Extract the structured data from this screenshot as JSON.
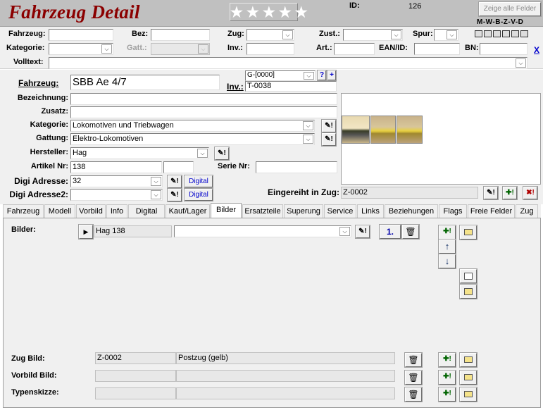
{
  "header": {
    "title": "Fahrzeug Detail",
    "stars": "★★★★★",
    "id_label": "ID:",
    "id_value": "126",
    "show_fields_button": "Zeige alle Felder",
    "mode_flags": "M-W-B-Z-V-D"
  },
  "filter": {
    "fahrzeug_label": "Fahrzeug:",
    "bez_label": "Bez:",
    "zug_label": "Zug:",
    "zust_label": "Zust.:",
    "spur_label": "Spur:",
    "kategorie_label": "Kategorie:",
    "gatt_label": "Gatt.:",
    "inv_label": "Inv.:",
    "art_label": "Art.:",
    "ean_label": "EAN/ID:",
    "bn_label": "BN:",
    "volltext_label": "Volltext:",
    "close_link": "X"
  },
  "detail": {
    "fahrzeug_label": "Fahrzeug:",
    "fahrzeug_value": "SBB Ae 4/7",
    "group_value": "G-[0000]",
    "question_button": "?",
    "plus_button": "+",
    "inv_label": "Inv.:",
    "inv_value": "T-0038",
    "bezeichnung_label": "Bezeichnung:",
    "bezeichnung_value": "",
    "zusatz_label": "Zusatz:",
    "zusatz_value": "",
    "kategorie_label": "Kategorie:",
    "kategorie_value": "Lokomotiven und Triebwagen",
    "gattung_label": "Gattung:",
    "gattung_value": "Elektro-Lokomotiven",
    "hersteller_label": "Hersteller:",
    "hersteller_value": "Hag",
    "artikel_label": "Artikel Nr:",
    "artikel_value": "138",
    "serie_label": "Serie Nr:",
    "serie_value": "",
    "digi1_label": "Digi Adresse:",
    "digi1_value": "32",
    "digi2_label": "Digi Adresse2:",
    "digi2_value": "",
    "digital_button": "Digital",
    "eingereiht_label": "Eingereiht in Zug:",
    "eingereiht_value": "Z-0002",
    "edit_icon": "✎!",
    "add_icon": "✚!",
    "delete_icon": "✖!"
  },
  "tabs": [
    "Fahrzeug",
    "Modell",
    "Vorbild",
    "Info",
    "Digital",
    "Kauf/Lager",
    "Bilder",
    "Ersatzteile",
    "Superung",
    "Service",
    "Links",
    "Beziehungen",
    "Flags",
    "Freie Felder",
    "Zug"
  ],
  "active_tab": "Bilder",
  "bilder": {
    "bilder_label": "Bilder:",
    "play_icon": "▶",
    "image_name": "Hag 138",
    "first_button": "1.",
    "trash_icon": "🗑",
    "up_icon": "↑",
    "down_icon": "↓",
    "zug_bild_label": "Zug Bild:",
    "zug_bild_id": "Z-0002",
    "zug_bild_name": "Postzug (gelb)",
    "vorbild_bild_label": "Vorbild Bild:",
    "typenskizze_label": "Typenskizze:"
  }
}
